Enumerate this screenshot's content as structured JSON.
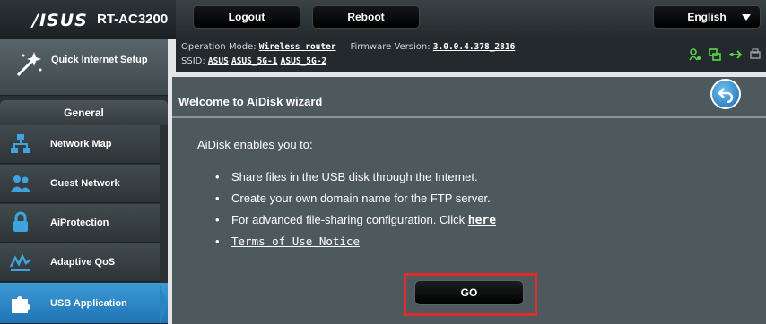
{
  "header": {
    "brand": "/ISUS",
    "model": "RT-AC3200",
    "logout_label": "Logout",
    "reboot_label": "Reboot",
    "language": "English"
  },
  "info": {
    "op_mode_label": "Operation Mode:",
    "op_mode_value": "Wireless router",
    "firmware_label": "Firmware Version:",
    "firmware_value": "3.0.0.4.378_2816",
    "ssid_label": "SSID:",
    "ssids": [
      "ASUS",
      "ASUS_5G-1",
      "ASUS_5G-2"
    ]
  },
  "sidebar": {
    "quick_setup": "Quick Internet Setup",
    "section_general": "General",
    "items": [
      {
        "label": "Network Map",
        "icon": "network-map-icon"
      },
      {
        "label": "Guest Network",
        "icon": "guest-network-icon"
      },
      {
        "label": "AiProtection",
        "icon": "lock-icon"
      },
      {
        "label": "Adaptive QoS",
        "icon": "qos-icon"
      },
      {
        "label": "USB Application",
        "icon": "puzzle-icon"
      }
    ]
  },
  "wizard": {
    "title": "Welcome to AiDisk wizard",
    "intro": "AiDisk enables you to:",
    "bullet1": "Share files in the USB disk through the Internet.",
    "bullet2": "Create your own domain name for the FTP server.",
    "bullet3": "For advanced file-sharing configuration. Click ",
    "bullet3_link": "here",
    "bullet4_link": "Terms of Use Notice",
    "go_label": "GO"
  },
  "colors": {
    "accent": "#2a85c4",
    "highlight": "#e02c2c",
    "status_green": "#59d64b"
  }
}
